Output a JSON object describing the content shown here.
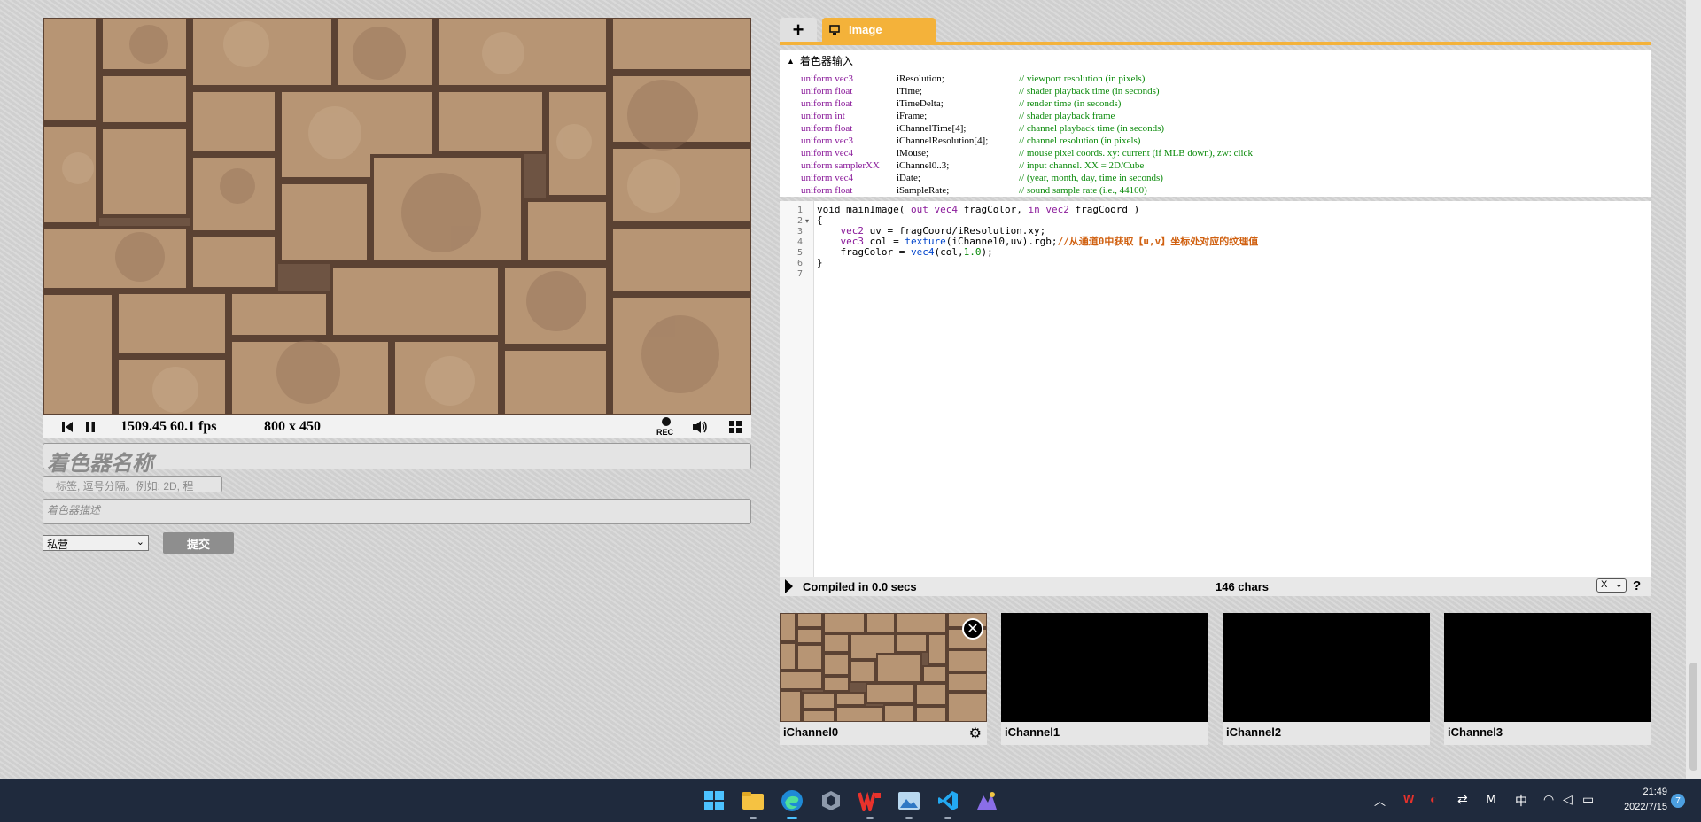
{
  "player": {
    "time_fps": "1509.45 60.1 fps",
    "resolution": "800 x 450",
    "rec_label": "REC"
  },
  "form": {
    "name_placeholder": "着色器名称",
    "tags_placeholder": "标签, 逗号分隔。例如: 2D, 程",
    "description_placeholder": "着色器描述",
    "privacy_value": "私营",
    "submit_label": "提交"
  },
  "editor": {
    "tab_label": "Image",
    "inputs_header": "着色器输入",
    "uniforms": [
      {
        "type": "uniform vec3",
        "name": "iResolution;",
        "comment": "// viewport resolution (in pixels)"
      },
      {
        "type": "uniform float",
        "name": "iTime;",
        "comment": "// shader playback time (in seconds)"
      },
      {
        "type": "uniform float",
        "name": "iTimeDelta;",
        "comment": "// render time (in seconds)"
      },
      {
        "type": "uniform int",
        "name": "iFrame;",
        "comment": "// shader playback frame"
      },
      {
        "type": "uniform float",
        "name": "iChannelTime[4];",
        "comment": "// channel playback time (in seconds)"
      },
      {
        "type": "uniform vec3",
        "name": "iChannelResolution[4];",
        "comment": "// channel resolution (in pixels)"
      },
      {
        "type": "uniform vec4",
        "name": "iMouse;",
        "comment": "// mouse pixel coords. xy: current (if MLB down), zw: click"
      },
      {
        "type": "uniform samplerXX",
        "name": "iChannel0..3;",
        "comment": "// input channel. XX = 2D/Cube"
      },
      {
        "type": "uniform vec4",
        "name": "iDate;",
        "comment": "// (year, month, day, time in seconds)"
      },
      {
        "type": "uniform float",
        "name": "iSampleRate;",
        "comment": "// sound sample rate (i.e., 44100)"
      }
    ],
    "line_numbers": [
      "1",
      "2",
      "3",
      "4",
      "5",
      "6",
      "7"
    ],
    "code": {
      "l1_a": "void mainImage( ",
      "l1_out": "out",
      "l1_t1": "vec4",
      "l1_b": " fragColor, ",
      "l1_in": "in",
      "l1_t2": "vec2",
      "l1_c": " fragCoord )",
      "l2": "{",
      "l3_t": "vec2",
      "l3_b": " uv = fragCoord/iResolution.xy;",
      "l4_t": "vec3",
      "l4_b": " col = ",
      "l4_fn": "texture",
      "l4_c": "(iChannel0,uv).rgb;",
      "l4_cmt": "//从通道0中获取【u,v】坐标处对应的纹理值",
      "l5_a": "fragColor = ",
      "l5_fn": "vec4",
      "l5_b": "(col,",
      "l5_num": "1.0",
      "l5_c": ");",
      "l6": "}"
    },
    "compile_status": "Compiled in 0.0 secs",
    "char_count": "146 chars",
    "x_select": "X",
    "help": "?"
  },
  "channels": [
    {
      "label": "iChannel0"
    },
    {
      "label": "iChannel1"
    },
    {
      "label": "iChannel2"
    },
    {
      "label": "iChannel3"
    }
  ],
  "taskbar": {
    "apps": [
      "windows-start-icon",
      "file-explorer-icon",
      "edge-icon",
      "sandbox-icon",
      "wps-icon",
      "photos-icon",
      "vscode-icon",
      "paint-icon"
    ],
    "ime": "中",
    "time": "21:49",
    "date": "2022/7/15",
    "notifications": "7"
  },
  "colors": {
    "accent": "#f4b23a",
    "uniform_type": "#8a1a9a",
    "comment": "#0a8a0a",
    "taskbar": "#1f2a3d"
  }
}
